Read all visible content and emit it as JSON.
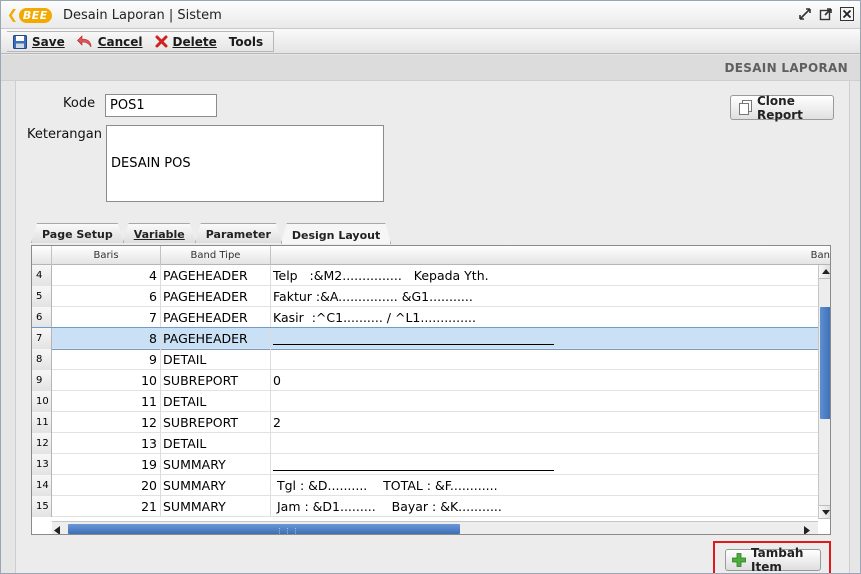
{
  "window": {
    "logo_text": "BEE",
    "title": "Desain Laporan | Sistem"
  },
  "toolbar": {
    "save_label": "Save",
    "cancel_label": "Cancel",
    "delete_label": "Delete",
    "tools_label": "Tools"
  },
  "header": {
    "title": "DESAIN LAPORAN"
  },
  "form": {
    "kode_label": "Kode",
    "kode_value": "POS1",
    "keterangan_label": "Keterangan",
    "keterangan_value": "DESAIN POS",
    "clone_button": "Clone Report"
  },
  "tabs": [
    {
      "label": "Page Setup",
      "active": false
    },
    {
      "label": "Variable",
      "active": false
    },
    {
      "label": "Parameter",
      "active": false
    },
    {
      "label": "Design Layout",
      "active": true
    }
  ],
  "grid": {
    "columns": [
      "Baris",
      "Band Tipe",
      "Ban"
    ],
    "rows": [
      {
        "row": "4",
        "baris": "4",
        "tipe": "PAGEHEADER",
        "band": "Telp   :&M2...............   Kepada Yth."
      },
      {
        "row": "5",
        "baris": "6",
        "tipe": "PAGEHEADER",
        "band": "Faktur :&A............... &G1..........."
      },
      {
        "row": "6",
        "baris": "7",
        "tipe": "PAGEHEADER",
        "band": "Kasir  :^C1.......... / ^L1.............."
      },
      {
        "row": "7",
        "baris": "8",
        "tipe": "PAGEHEADER",
        "band": "",
        "rule": true,
        "selected": true
      },
      {
        "row": "8",
        "baris": "9",
        "tipe": "DETAIL",
        "band": ""
      },
      {
        "row": "9",
        "baris": "10",
        "tipe": "SUBREPORT",
        "band": "0"
      },
      {
        "row": "10",
        "baris": "11",
        "tipe": "DETAIL",
        "band": ""
      },
      {
        "row": "11",
        "baris": "12",
        "tipe": "SUBREPORT",
        "band": "2"
      },
      {
        "row": "12",
        "baris": "13",
        "tipe": "DETAIL",
        "band": ""
      },
      {
        "row": "13",
        "baris": "19",
        "tipe": "SUMMARY",
        "band": "",
        "rule": true
      },
      {
        "row": "14",
        "baris": "20",
        "tipe": "SUMMARY",
        "band": " Tgl : &D..........    TOTAL : &F............"
      },
      {
        "row": "15",
        "baris": "21",
        "tipe": "SUMMARY",
        "band": " Jam : &D1.........    Bayar : &K..........."
      }
    ]
  },
  "footer": {
    "add_item_label": "Tambah Item"
  },
  "colors": {
    "accent_logo": "#f2a900",
    "selection": "#c9e0f5",
    "scroll_thumb": "#3c6fb6",
    "highlight_box": "#e01a1a"
  }
}
